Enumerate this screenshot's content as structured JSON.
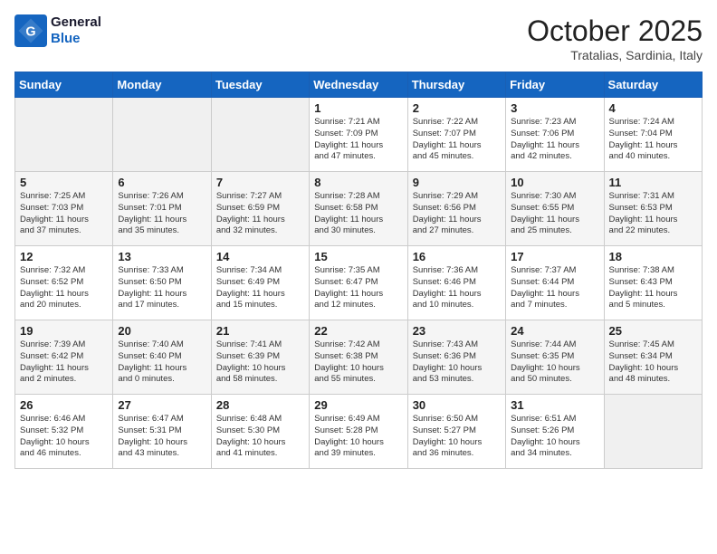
{
  "header": {
    "logo_line1": "General",
    "logo_line2": "Blue",
    "month": "October 2025",
    "location": "Tratalias, Sardinia, Italy"
  },
  "days_of_week": [
    "Sunday",
    "Monday",
    "Tuesday",
    "Wednesday",
    "Thursday",
    "Friday",
    "Saturday"
  ],
  "weeks": [
    [
      {
        "num": "",
        "info": ""
      },
      {
        "num": "",
        "info": ""
      },
      {
        "num": "",
        "info": ""
      },
      {
        "num": "1",
        "info": "Sunrise: 7:21 AM\nSunset: 7:09 PM\nDaylight: 11 hours\nand 47 minutes."
      },
      {
        "num": "2",
        "info": "Sunrise: 7:22 AM\nSunset: 7:07 PM\nDaylight: 11 hours\nand 45 minutes."
      },
      {
        "num": "3",
        "info": "Sunrise: 7:23 AM\nSunset: 7:06 PM\nDaylight: 11 hours\nand 42 minutes."
      },
      {
        "num": "4",
        "info": "Sunrise: 7:24 AM\nSunset: 7:04 PM\nDaylight: 11 hours\nand 40 minutes."
      }
    ],
    [
      {
        "num": "5",
        "info": "Sunrise: 7:25 AM\nSunset: 7:03 PM\nDaylight: 11 hours\nand 37 minutes."
      },
      {
        "num": "6",
        "info": "Sunrise: 7:26 AM\nSunset: 7:01 PM\nDaylight: 11 hours\nand 35 minutes."
      },
      {
        "num": "7",
        "info": "Sunrise: 7:27 AM\nSunset: 6:59 PM\nDaylight: 11 hours\nand 32 minutes."
      },
      {
        "num": "8",
        "info": "Sunrise: 7:28 AM\nSunset: 6:58 PM\nDaylight: 11 hours\nand 30 minutes."
      },
      {
        "num": "9",
        "info": "Sunrise: 7:29 AM\nSunset: 6:56 PM\nDaylight: 11 hours\nand 27 minutes."
      },
      {
        "num": "10",
        "info": "Sunrise: 7:30 AM\nSunset: 6:55 PM\nDaylight: 11 hours\nand 25 minutes."
      },
      {
        "num": "11",
        "info": "Sunrise: 7:31 AM\nSunset: 6:53 PM\nDaylight: 11 hours\nand 22 minutes."
      }
    ],
    [
      {
        "num": "12",
        "info": "Sunrise: 7:32 AM\nSunset: 6:52 PM\nDaylight: 11 hours\nand 20 minutes."
      },
      {
        "num": "13",
        "info": "Sunrise: 7:33 AM\nSunset: 6:50 PM\nDaylight: 11 hours\nand 17 minutes."
      },
      {
        "num": "14",
        "info": "Sunrise: 7:34 AM\nSunset: 6:49 PM\nDaylight: 11 hours\nand 15 minutes."
      },
      {
        "num": "15",
        "info": "Sunrise: 7:35 AM\nSunset: 6:47 PM\nDaylight: 11 hours\nand 12 minutes."
      },
      {
        "num": "16",
        "info": "Sunrise: 7:36 AM\nSunset: 6:46 PM\nDaylight: 11 hours\nand 10 minutes."
      },
      {
        "num": "17",
        "info": "Sunrise: 7:37 AM\nSunset: 6:44 PM\nDaylight: 11 hours\nand 7 minutes."
      },
      {
        "num": "18",
        "info": "Sunrise: 7:38 AM\nSunset: 6:43 PM\nDaylight: 11 hours\nand 5 minutes."
      }
    ],
    [
      {
        "num": "19",
        "info": "Sunrise: 7:39 AM\nSunset: 6:42 PM\nDaylight: 11 hours\nand 2 minutes."
      },
      {
        "num": "20",
        "info": "Sunrise: 7:40 AM\nSunset: 6:40 PM\nDaylight: 11 hours\nand 0 minutes."
      },
      {
        "num": "21",
        "info": "Sunrise: 7:41 AM\nSunset: 6:39 PM\nDaylight: 10 hours\nand 58 minutes."
      },
      {
        "num": "22",
        "info": "Sunrise: 7:42 AM\nSunset: 6:38 PM\nDaylight: 10 hours\nand 55 minutes."
      },
      {
        "num": "23",
        "info": "Sunrise: 7:43 AM\nSunset: 6:36 PM\nDaylight: 10 hours\nand 53 minutes."
      },
      {
        "num": "24",
        "info": "Sunrise: 7:44 AM\nSunset: 6:35 PM\nDaylight: 10 hours\nand 50 minutes."
      },
      {
        "num": "25",
        "info": "Sunrise: 7:45 AM\nSunset: 6:34 PM\nDaylight: 10 hours\nand 48 minutes."
      }
    ],
    [
      {
        "num": "26",
        "info": "Sunrise: 6:46 AM\nSunset: 5:32 PM\nDaylight: 10 hours\nand 46 minutes."
      },
      {
        "num": "27",
        "info": "Sunrise: 6:47 AM\nSunset: 5:31 PM\nDaylight: 10 hours\nand 43 minutes."
      },
      {
        "num": "28",
        "info": "Sunrise: 6:48 AM\nSunset: 5:30 PM\nDaylight: 10 hours\nand 41 minutes."
      },
      {
        "num": "29",
        "info": "Sunrise: 6:49 AM\nSunset: 5:28 PM\nDaylight: 10 hours\nand 39 minutes."
      },
      {
        "num": "30",
        "info": "Sunrise: 6:50 AM\nSunset: 5:27 PM\nDaylight: 10 hours\nand 36 minutes."
      },
      {
        "num": "31",
        "info": "Sunrise: 6:51 AM\nSunset: 5:26 PM\nDaylight: 10 hours\nand 34 minutes."
      },
      {
        "num": "",
        "info": ""
      }
    ]
  ]
}
